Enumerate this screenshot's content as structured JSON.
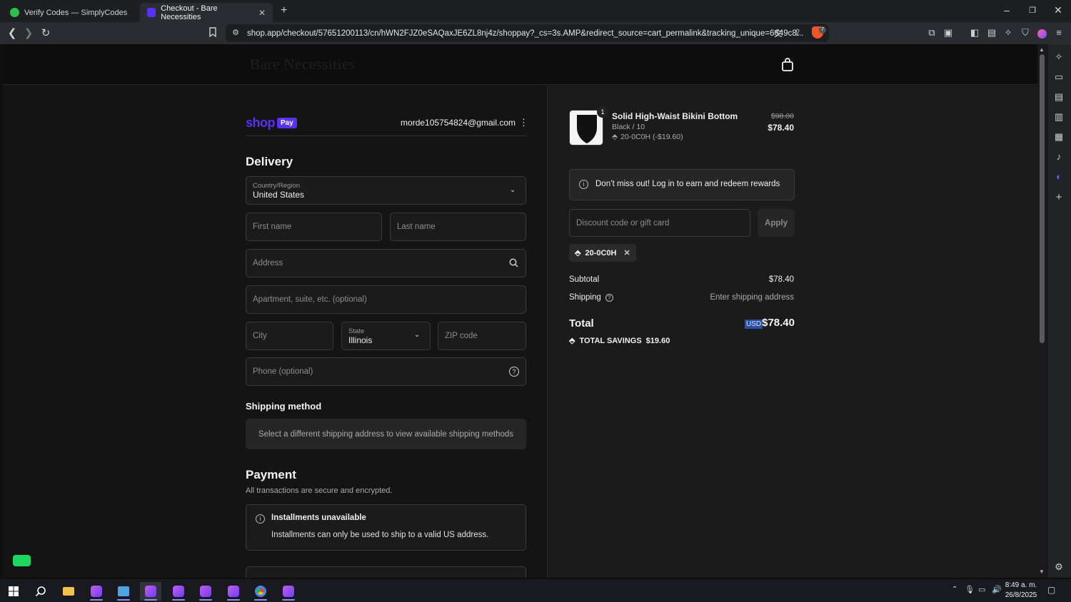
{
  "browser": {
    "tabs": [
      {
        "title": "Verify Codes — SimplyCodes",
        "active": false
      },
      {
        "title": "Checkout - Bare Necessities",
        "active": true
      }
    ],
    "new_tab": "+",
    "url": "shop.app/checkout/57651200113/cn/hWN2FJZ0eSAQaxJE6ZL8nj4z/shoppay?_cs=3s.AMP&redirect_source=cart_permalink&tracking_unique=6649c8...",
    "brave_badge": "7"
  },
  "store": {
    "name": "Bare Necessities"
  },
  "checkout": {
    "shop_logo": "shop",
    "pay_badge": "Pay",
    "email": "morde105754824@gmail.com",
    "delivery_heading": "Delivery",
    "country_label": "Country/Region",
    "country_value": "United States",
    "first_name_placeholder": "First name",
    "last_name_placeholder": "Last name",
    "address_placeholder": "Address",
    "apartment_placeholder": "Apartment, suite, etc. (optional)",
    "city_placeholder": "City",
    "state_label": "State",
    "state_value": "Illinois",
    "zip_placeholder": "ZIP code",
    "phone_placeholder": "Phone (optional)",
    "shipping_heading": "Shipping method",
    "shipping_note": "Select a different shipping address to view available shipping methods",
    "payment_heading": "Payment",
    "payment_subtitle": "All transactions are secure and encrypted.",
    "installments_title": "Installments unavailable",
    "installments_text": "Installments can only be used to ship to a valid US address."
  },
  "summary": {
    "product_name": "Solid High-Waist Bikini Bottom",
    "product_variant": "Black / 10",
    "product_discount": "20-0C0H (-$19.60)",
    "quantity_badge": "1",
    "original_price": "$98.00",
    "price": "$78.40",
    "rewards_text": "Don’t miss out! Log in to earn and redeem rewards",
    "discount_placeholder": "Discount code or gift card",
    "apply_label": "Apply",
    "applied_code": "20-0C0H",
    "subtotal_label": "Subtotal",
    "subtotal_value": "$78.40",
    "shipping_label": "Shipping",
    "shipping_value": "Enter shipping address",
    "total_label": "Total",
    "currency": "USD",
    "total_value": "$78.40",
    "savings_label": "TOTAL SAVINGS",
    "savings_value": "$19.60"
  },
  "taskbar": {
    "time": "8:49 a. m.",
    "date": "26/8/2025"
  },
  "colors": {
    "shop_purple": "#5a31f4",
    "usd_highlight": "#2a4ea8"
  }
}
